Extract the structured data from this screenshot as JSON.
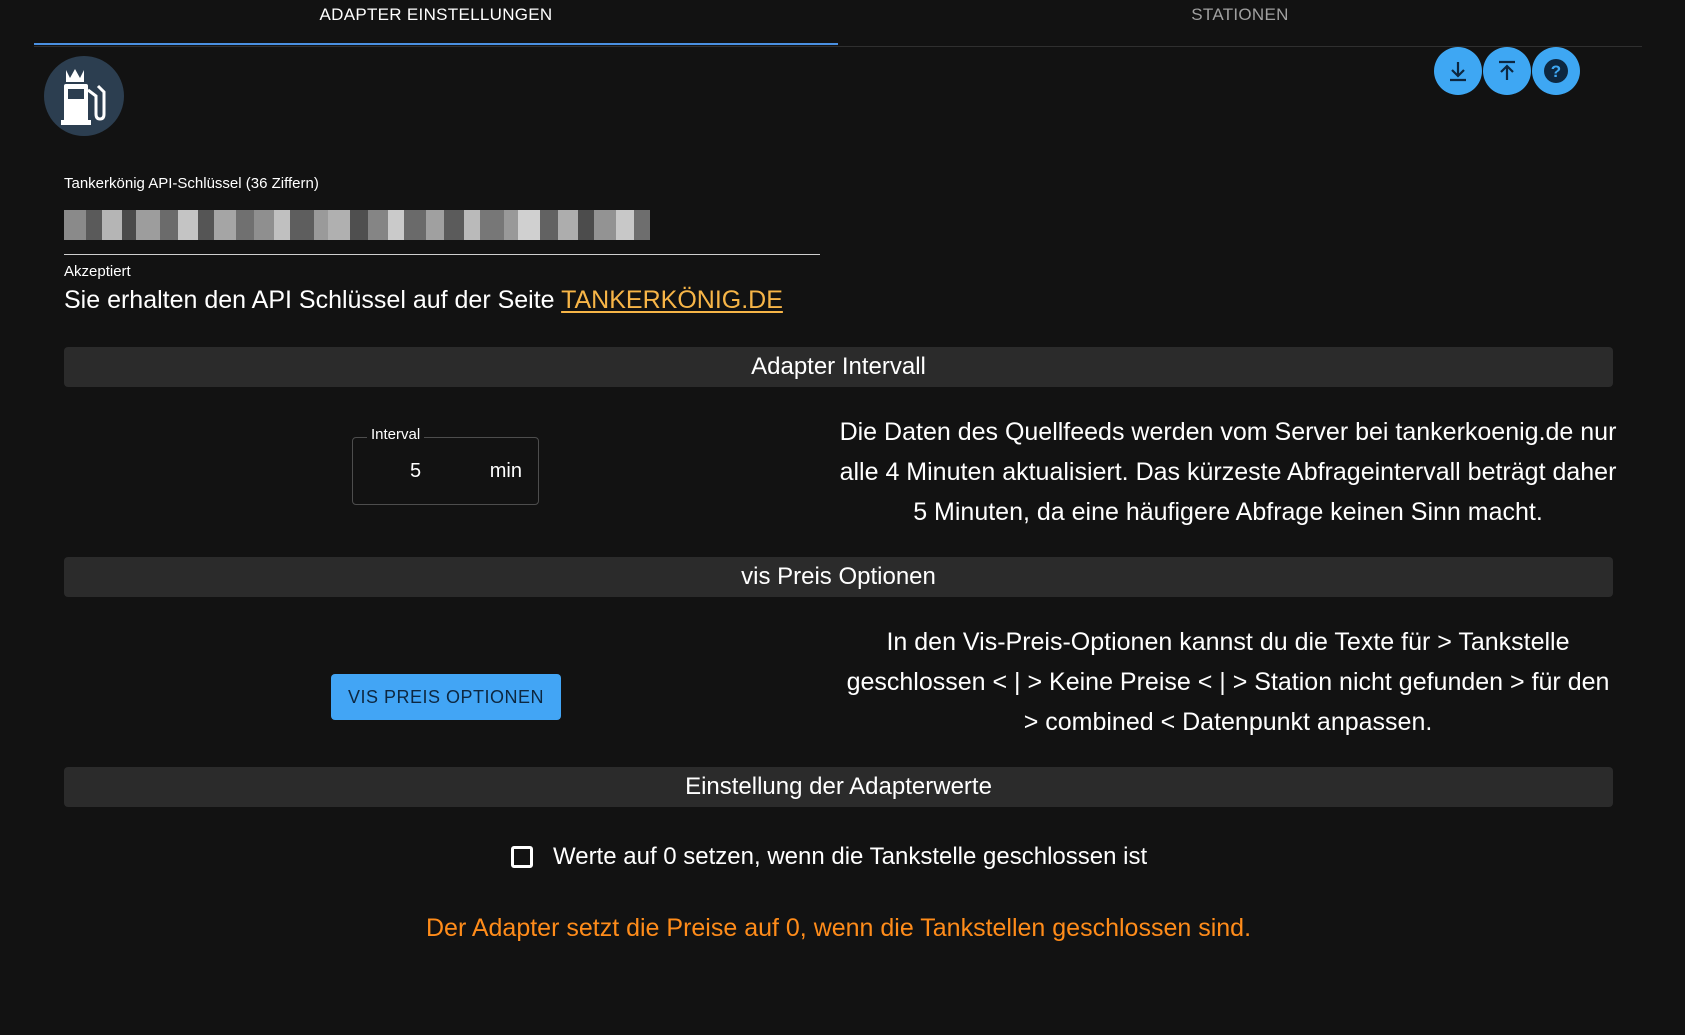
{
  "tabs": [
    {
      "label": "ADAPTER EINSTELLUNGEN",
      "active": true
    },
    {
      "label": "STATIONEN",
      "active": false
    }
  ],
  "toolbar": {
    "download_icon": "download-icon",
    "upload_icon": "upload-icon",
    "help_icon": "help-icon",
    "accent": "#3ea7f3"
  },
  "api_key": {
    "label": "Tankerkönig API-Schlüssel (36 Ziffern)",
    "value_obscured": true,
    "helper": "Akzeptiert",
    "info_text": "Sie erhalten den API Schlüssel auf der Seite ",
    "link_text": "TANKERKÖNIG.DE",
    "link_color": "#f7b547"
  },
  "sections": {
    "interval": {
      "title": "Adapter Intervall",
      "field_label": "Interval",
      "field_value": "5",
      "field_unit": "min",
      "description": "Die Daten des Quellfeeds werden vom Server bei tankerkoenig.de nur alle 4 Minuten aktualisiert. Das kürzeste Abfrageintervall beträgt daher 5 Minuten, da eine häufigere Abfrage keinen Sinn macht."
    },
    "vis": {
      "title": "vis Preis Optionen",
      "button_label": "VIS PREIS OPTIONEN",
      "description": "In den Vis-Preis-Optionen kannst du die Texte für > Tankstelle geschlossen < | > Keine Preise < | > Station nicht gefunden > für den > combined < Datenpunkt anpassen."
    },
    "values": {
      "title": "Einstellung der Adapterwerte",
      "checkbox_label": "Werte auf 0 setzen, wenn die Tankstelle geschlossen ist",
      "checkbox_checked": false,
      "warning": "Der Adapter setzt die Preise auf 0, wenn die Tankstellen geschlossen sind.",
      "warning_color": "#ff8c1a"
    }
  }
}
